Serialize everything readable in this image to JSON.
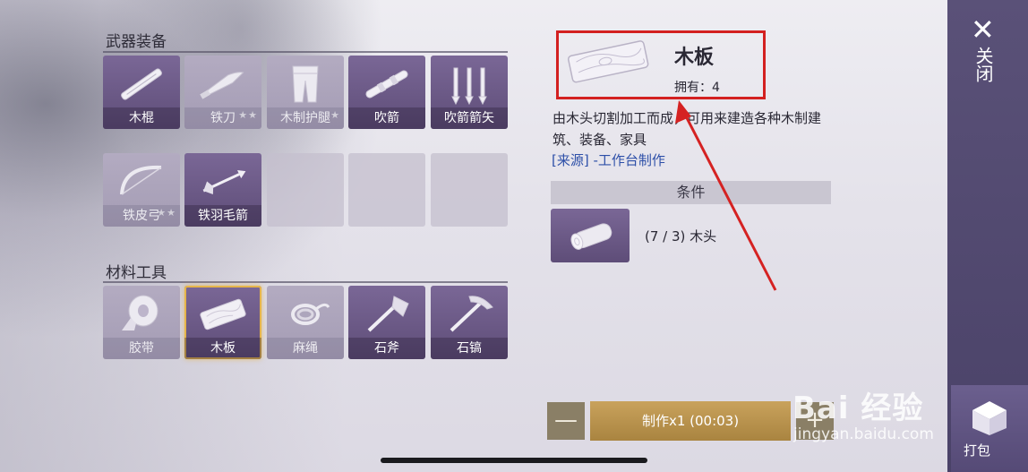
{
  "sections": {
    "weapons_title": "武器装备",
    "materials_title": "材料工具"
  },
  "weapons": [
    {
      "label": "木棍",
      "state": "active",
      "stars": ""
    },
    {
      "label": "铁刀",
      "state": "dim",
      "stars": "★★"
    },
    {
      "label": "木制护腿",
      "state": "dim",
      "stars": "★"
    },
    {
      "label": "吹箭",
      "state": "active",
      "stars": ""
    },
    {
      "label": "吹箭箭矢",
      "state": "active",
      "stars": ""
    },
    {
      "label": "铁皮弓",
      "state": "dim",
      "stars": "★★"
    },
    {
      "label": "铁羽毛箭",
      "state": "active",
      "stars": ""
    }
  ],
  "materials": [
    {
      "label": "胶带",
      "state": "dim"
    },
    {
      "label": "木板",
      "state": "active",
      "selected": true
    },
    {
      "label": "麻绳",
      "state": "dim"
    },
    {
      "label": "石斧",
      "state": "active"
    },
    {
      "label": "石镐",
      "state": "active"
    }
  ],
  "detail": {
    "name": "木板",
    "owned": "拥有：4",
    "description": "由木头切割加工而成，可用来建造各种木制建筑、装备、家具",
    "source": "[来源] -工作台制作",
    "conditions_title": "条件",
    "condition_text": "(7 / 3) 木头"
  },
  "craft": {
    "minus": "—",
    "button_label": "制作x1 (00:03)",
    "plus": "+"
  },
  "side_panel": {
    "close_icon": "✕",
    "close_label": "关闭",
    "pack_label": "打包"
  },
  "watermark": {
    "main": "Bai 经验",
    "sub": "jingyan.baidu.com"
  },
  "colors": {
    "tile_active": "#6b5a88",
    "tile_dim": "#aba3bb",
    "selected_outline": "#e6b54a",
    "highlight_box": "#d32020",
    "craft_button": "#b8934e",
    "side_panel": "#52496f"
  }
}
